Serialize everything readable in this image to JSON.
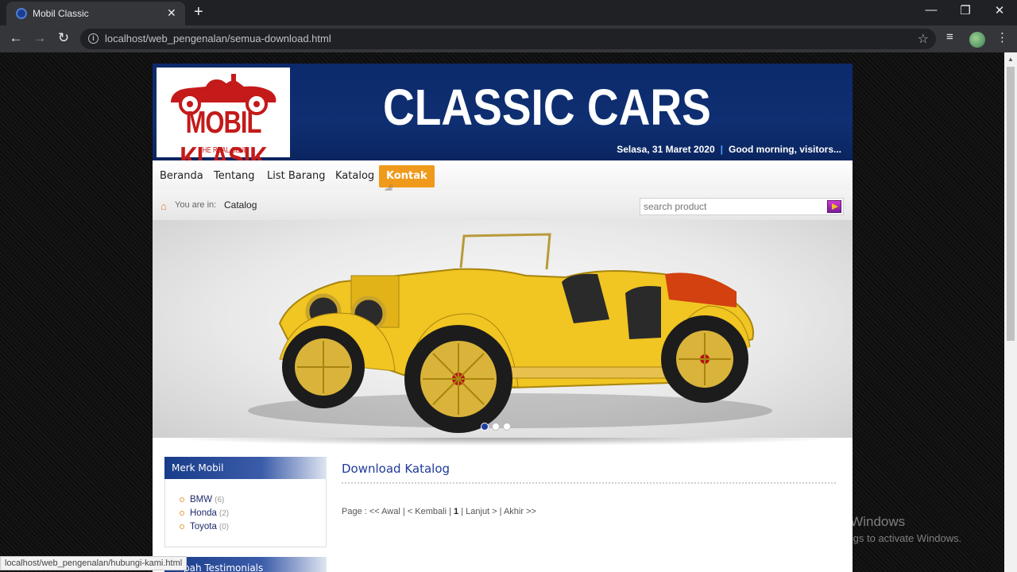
{
  "browser": {
    "tab_title": "Mobil Classic",
    "tab_close": "✕",
    "new_tab": "+",
    "url": "localhost/web_pengenalan/semua-download.html",
    "window_minimize": "—",
    "window_restore": "❐",
    "window_close": "✕",
    "status_url": "localhost/web_pengenalan/hubungi-kami.html"
  },
  "header": {
    "logo_text": "MOBIL KLASIK",
    "logo_subtitle": "THE REAL CLUB",
    "site_title": "CLASSIC CARS",
    "date": "Selasa, 31 Maret 2020",
    "separator": "|",
    "greeting": "Good morning, visitors..."
  },
  "menu": {
    "items": [
      {
        "label": "Beranda"
      },
      {
        "label": "Tentang"
      },
      {
        "label": "List Barang"
      },
      {
        "label": "Katalog"
      },
      {
        "label": "Kontak"
      }
    ]
  },
  "breadcrumb": {
    "label": "You are in:",
    "current": "Catalog"
  },
  "search": {
    "placeholder": "search product"
  },
  "slider": {
    "dot_count": 3,
    "active_dot": 1
  },
  "sidebar": {
    "title": "Merk Mobil",
    "brands": [
      {
        "name": "BMW",
        "count": "(6)"
      },
      {
        "name": "Honda",
        "count": "(2)"
      },
      {
        "name": "Toyota",
        "count": "(0)"
      }
    ],
    "second_title": "pah Testimonials"
  },
  "main": {
    "title": "Download Katalog",
    "pager": {
      "prefix": "Page :",
      "first": "<< Awal",
      "prev": "< Kembali",
      "current": "1",
      "next": "Lanjut >",
      "last": "Akhir >>",
      "sep": "|"
    }
  },
  "watermark": {
    "line1": "Activate Windows",
    "line2": "Go to Settings to activate Windows."
  },
  "colors": {
    "header_blue": "#0f2f72",
    "menu_active": "#f09a1c",
    "link_blue": "#1f3a9a",
    "logo_red": "#c41a1a"
  }
}
